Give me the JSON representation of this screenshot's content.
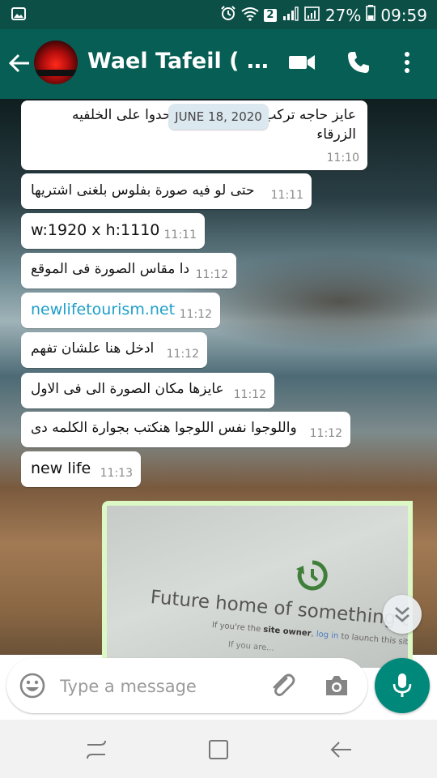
{
  "status_bar": {
    "sim_badge": "2",
    "battery": "27%",
    "time": "09:59",
    "icons": [
      "image-icon",
      "alarm-icon",
      "wifi-icon",
      "signal-icon",
      "battery-icon"
    ]
  },
  "header": {
    "contact_name": "Wael Tafeil ( Image...",
    "icons": [
      "back-arrow-icon",
      "video-call-icon",
      "phone-icon",
      "more-vert-icon"
    ]
  },
  "chat": {
    "date_chip": "JUNE 18, 2020",
    "messages": [
      {
        "text_line1": "عايز حاجه تركب عليها الصورة وتحدوا على الخلفيه",
        "text_line2": "الزرقاء",
        "time": "11:10"
      },
      {
        "text": "حتى لو فيه صورة بفلوس بلغنى اشتريها",
        "time": "11:11"
      },
      {
        "text": "w:1920  x h:1110",
        "time": "11:11"
      },
      {
        "text": "دا مقاس الصورة فى الموقع",
        "time": "11:12"
      },
      {
        "text": "newlifetourism.net",
        "time": "11:12"
      },
      {
        "text": "ادخل هنا علشان تفهم",
        "time": "11:12"
      },
      {
        "text": "عايزها مكان الصورة الى فى الاول",
        "time": "11:12"
      },
      {
        "text": "واللوجوا نفس اللوجوا هنكتب بجوارة الكلمه دى",
        "time": "11:12"
      },
      {
        "text": "new life",
        "time": "11:13"
      }
    ],
    "image_message": {
      "line1": "Future home of something qu",
      "line2_pre": "If you're the ",
      "line2_bold": "site owner",
      "line2_mid": ", ",
      "line2_link": "log in",
      "line2_post": " to launch this site",
      "line3": "If you are..."
    }
  },
  "composer": {
    "placeholder": "Type a message",
    "accent_color": "#00897b"
  },
  "colors": {
    "header_bg": "#075e54",
    "status_bg": "#0b4f46",
    "outgoing_bubble": "#dcf8c6",
    "link": "#1e9ec9"
  }
}
